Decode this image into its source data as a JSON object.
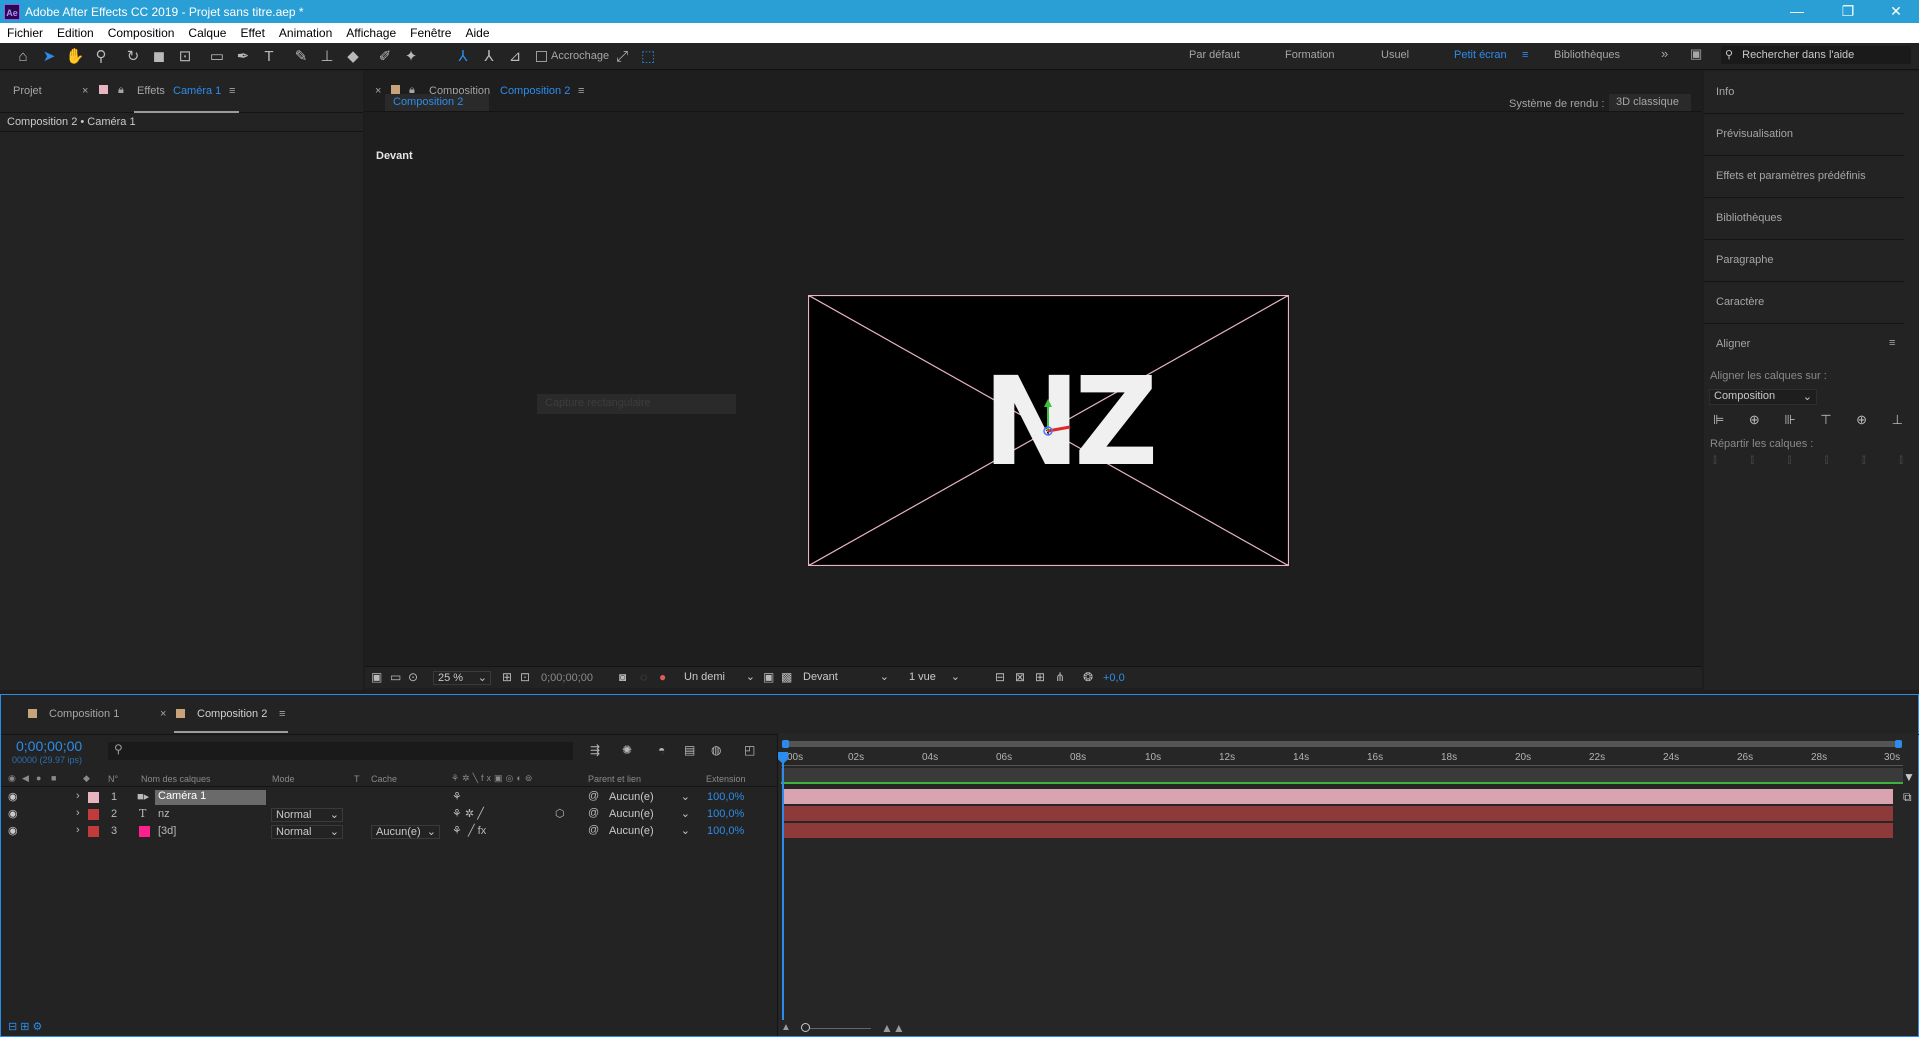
{
  "window": {
    "title": "Adobe After Effects CC 2019 - Projet sans titre.aep *",
    "app_badge": "Ae",
    "minimize": "—",
    "restore": "❐",
    "close": "✕"
  },
  "menu": [
    "Fichier",
    "Edition",
    "Composition",
    "Calque",
    "Effet",
    "Animation",
    "Affichage",
    "Fenêtre",
    "Aide"
  ],
  "toolbar": {
    "snap_label": "Accrochage"
  },
  "workspaces": {
    "items": [
      "Par défaut",
      "Formation",
      "Usuel",
      "Petit écran",
      "Bibliothèques"
    ],
    "active": "Petit écran",
    "search_placeholder": "Rechercher dans l'aide"
  },
  "project_panel": {
    "tab_project": "Projet",
    "tab_effects_prefix": "Effets",
    "tab_effects_target": "Caméra 1",
    "breadcrumb": "Composition 2 • Caméra 1"
  },
  "comp_panel": {
    "tab_prefix": "Composition",
    "tab_name": "Composition 2",
    "subtab": "Composition 2",
    "renderer_label": "Système de rendu :",
    "renderer_value": "3D classique",
    "view_label": "Devant",
    "viewport_text": "NZ",
    "hidden_tooltip": "Capture rectangulaire"
  },
  "viewer_footer": {
    "zoom": "25 %",
    "timecode": "0;00;00;00",
    "resolution": "Un demi",
    "view": "Devant",
    "views_count": "1 vue",
    "exposure": "+0,0"
  },
  "right_panel": {
    "items": [
      "Info",
      "Prévisualisation",
      "Effets et paramètres prédéfinis",
      "Bibliothèques",
      "Paragraphe",
      "Caractère"
    ],
    "align_title": "Aligner",
    "align_to_label": "Aligner les calques sur :",
    "align_to_value": "Composition",
    "distribute_label": "Répartir les calques :"
  },
  "timeline": {
    "tabs": [
      "Composition 1",
      "Composition 2"
    ],
    "active_tab": "Composition 2",
    "timecode": "0;00;00;00",
    "fps": "00000 (29.97 ips)",
    "columns": {
      "num": "N°",
      "name": "Nom des calques",
      "mode": "Mode",
      "t": "T",
      "cache": "Cache",
      "parent": "Parent et lien",
      "stretch": "Extension"
    },
    "layers": [
      {
        "num": "1",
        "name": "Caméra 1",
        "type_icon": "camera",
        "mode": "",
        "cache": "",
        "parent": "Aucun(e)",
        "stretch": "100,0%",
        "label_color": "#e8b4c0"
      },
      {
        "num": "2",
        "name": "nz",
        "type_icon": "T",
        "mode": "Normal",
        "cache": "",
        "parent": "Aucun(e)",
        "stretch": "100,0%",
        "label_color": "#c23b3b"
      },
      {
        "num": "3",
        "name": "[3d]",
        "type_icon": "solid",
        "mode": "Normal",
        "cache": "Aucun(e)",
        "parent": "Aucun(e)",
        "stretch": "100,0%",
        "label_color": "#c23b3b"
      }
    ],
    "ruler": [
      "00s",
      "02s",
      "04s",
      "06s",
      "08s",
      "10s",
      "12s",
      "14s",
      "16s",
      "18s",
      "20s",
      "22s",
      "24s",
      "26s",
      "28s",
      "30s"
    ]
  },
  "colors": {
    "accent": "#2d8ceb",
    "titlebar": "#2a9fd6",
    "camera_bar": "#d9a3b0",
    "layer_bar": "#8e3a3a",
    "solid_swatch": "#ff1f8f"
  }
}
